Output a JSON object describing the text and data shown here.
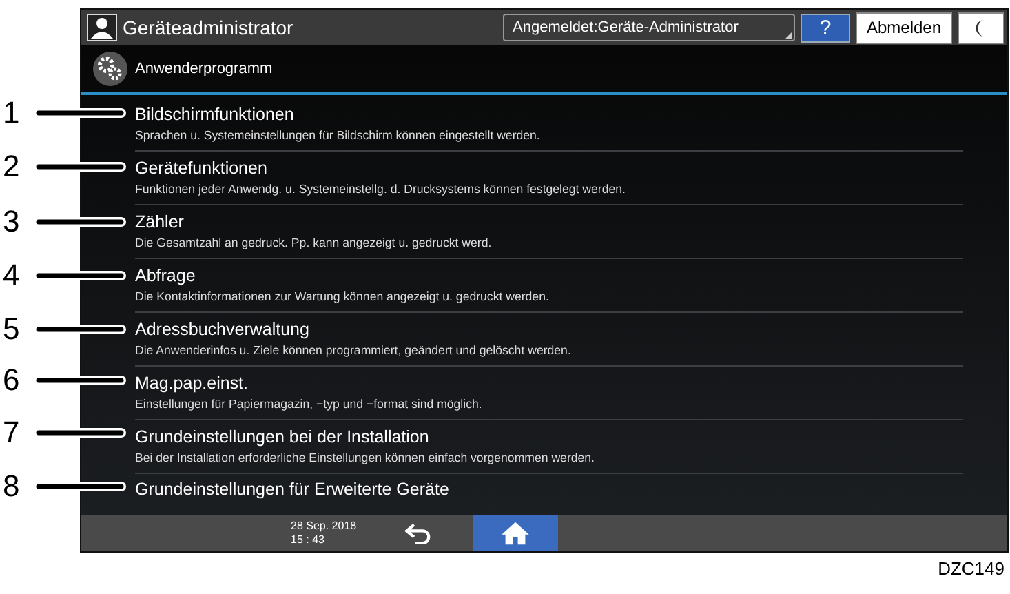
{
  "header": {
    "title": "Geräteadministrator",
    "login_status": "Angemeldet:Geräte-Administrator",
    "help": "?",
    "logout": "Abmelden"
  },
  "subheader": {
    "title": "Anwenderprogramm"
  },
  "items": [
    {
      "title": "Bildschirmfunktionen",
      "description": "Sprachen u. Systemeinstellungen für Bildschirm können eingestellt werden."
    },
    {
      "title": "Gerätefunktionen",
      "description": "Funktionen jeder Anwendg. u. Systemeinstellg. d. Drucksystems können festgelegt werden."
    },
    {
      "title": "Zähler",
      "description": "Die Gesamtzahl an gedruck. Pp. kann angezeigt u. gedruckt werd."
    },
    {
      "title": "Abfrage",
      "description": "Die Kontaktinformationen zur Wartung können angezeigt u. gedruckt werden."
    },
    {
      "title": "Adressbuchverwaltung",
      "description": "Die Anwenderinfos u. Ziele können programmiert, geändert und gelöscht werden."
    },
    {
      "title": "Mag.pap.einst.",
      "description": "Einstellungen für Papiermagazin, −typ und −format sind möglich."
    },
    {
      "title": "Grundeinstellungen bei der Installation",
      "description": "Bei der Installation erforderliche Einstellungen können einfach vorgenommen werden."
    },
    {
      "title": "Grundeinstellungen für Erweiterte Geräte"
    }
  ],
  "footer": {
    "date": "28 Sep. 2018",
    "time": "15 : 43"
  },
  "callouts": [
    "1",
    "2",
    "3",
    "4",
    "5",
    "6",
    "7",
    "8"
  ],
  "caption": "DZC149"
}
